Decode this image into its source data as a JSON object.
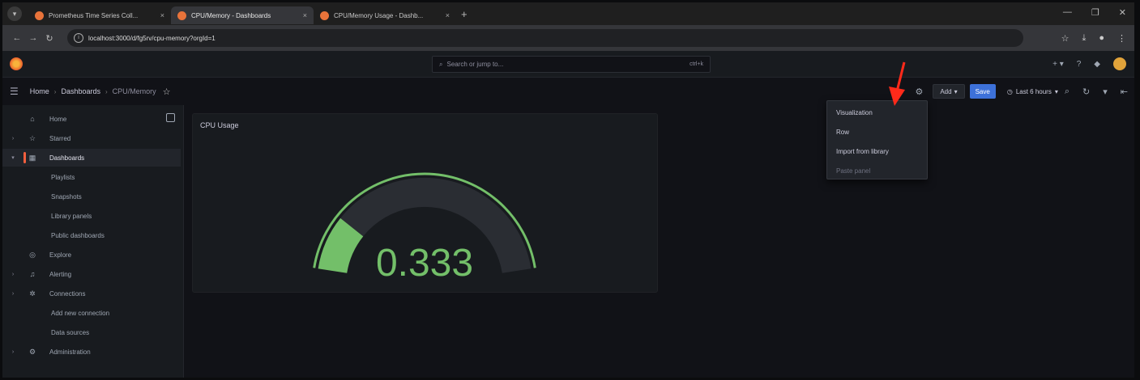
{
  "browser": {
    "tabs": [
      {
        "title": "Prometheus Time Series Coll...",
        "active": false
      },
      {
        "title": "CPU/Memory - Dashboards",
        "active": true
      },
      {
        "title": "CPU/Memory Usage - Dashb...",
        "active": false
      }
    ],
    "new_tab": "+",
    "url": "localhost:3000/d/fg5rv/cpu-memory?orgId=1"
  },
  "grafana": {
    "search_placeholder": "Search or jump to...",
    "search_shortcut": "ctrl+k",
    "breadcrumbs": [
      "Home",
      "Dashboards",
      "CPU/Memory"
    ],
    "toolbar": {
      "add_label": "Add",
      "save_label": "Save",
      "time_range": "Last 6 hours"
    },
    "sidebar": [
      {
        "label": "Home",
        "icon": "home-icon",
        "expandable": false,
        "sub": false,
        "active": false
      },
      {
        "label": "Starred",
        "icon": "star-icon",
        "expandable": true,
        "sub": false,
        "active": false
      },
      {
        "label": "Dashboards",
        "icon": "dashboards-icon",
        "expandable": true,
        "sub": false,
        "active": true
      },
      {
        "label": "Playlists",
        "sub": true
      },
      {
        "label": "Snapshots",
        "sub": true
      },
      {
        "label": "Library panels",
        "sub": true
      },
      {
        "label": "Public dashboards",
        "sub": true
      },
      {
        "label": "Explore",
        "icon": "compass-icon",
        "expandable": false,
        "sub": false,
        "active": false
      },
      {
        "label": "Alerting",
        "icon": "bell-icon",
        "expandable": true,
        "sub": false,
        "active": false
      },
      {
        "label": "Connections",
        "icon": "connections-icon",
        "expandable": true,
        "sub": false,
        "active": false
      },
      {
        "label": "Add new connection",
        "sub": true
      },
      {
        "label": "Data sources",
        "sub": true
      },
      {
        "label": "Administration",
        "icon": "gear-icon",
        "expandable": true,
        "sub": false,
        "active": false
      }
    ],
    "panel": {
      "title": "CPU Usage",
      "value": "0.333",
      "gauge_fraction": 0.333,
      "gauge_color": "#73bf69"
    },
    "add_menu": [
      "Visualization",
      "Row",
      "Import from library",
      "Paste panel"
    ]
  },
  "colors": {
    "accent": "#3d71d9",
    "annotation_arrow": "#ff2a1a",
    "active_marker": "#f55f3e"
  }
}
